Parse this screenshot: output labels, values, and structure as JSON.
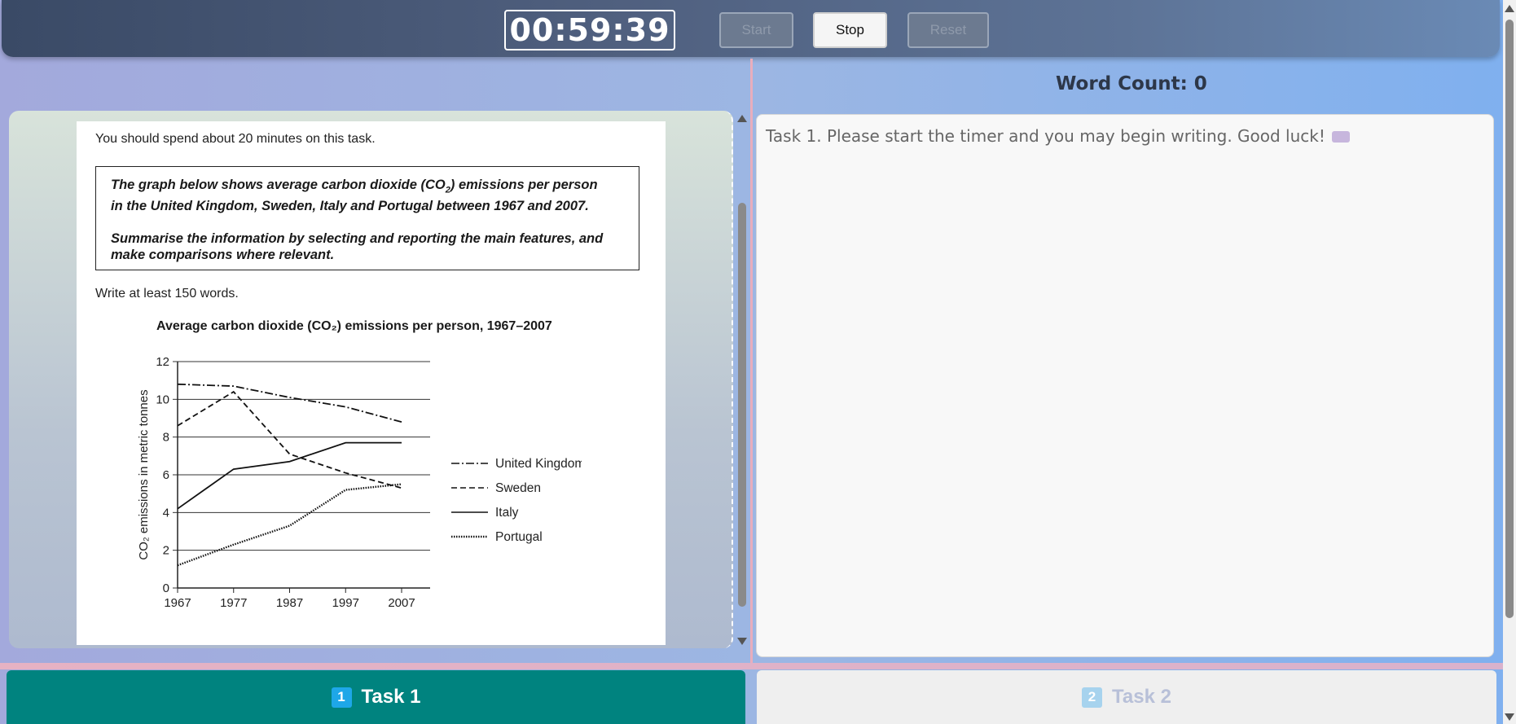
{
  "timer": {
    "value": "00:59:39"
  },
  "controls": {
    "start": "Start",
    "stop": "Stop",
    "reset": "Reset"
  },
  "task_paper": {
    "instruction": "You should spend about 20 minutes on this task.",
    "prompt_line1": "The graph below shows average carbon dioxide (CO",
    "prompt_sub": "2",
    "prompt_line1_end": ") emissions per person",
    "prompt_line2": "in the United Kingdom, Sweden, Italy and Portugal between 1967 and 2007.",
    "prompt_line3": "Summarise the information by selecting and reporting the main features, and",
    "prompt_line4": "make comparisons where relevant.",
    "min_words": "Write at least 150 words."
  },
  "chart_data": {
    "type": "line",
    "title": "Average carbon dioxide (CO₂) emissions per person, 1967–2007",
    "ylabel": "CO₂ emissions in metric tonnes",
    "xlabel": "",
    "x": [
      1967,
      1977,
      1987,
      1997,
      2007
    ],
    "ylim": [
      0,
      12
    ],
    "yticks": [
      0,
      2,
      4,
      6,
      8,
      10,
      12
    ],
    "grid": true,
    "legend_position": "right",
    "series": [
      {
        "name": "United Kingdom",
        "style": "dash-dot",
        "values": [
          10.8,
          10.7,
          10.1,
          9.6,
          8.8
        ]
      },
      {
        "name": "Sweden",
        "style": "dashed",
        "values": [
          8.6,
          10.4,
          7.1,
          6.1,
          5.3
        ]
      },
      {
        "name": "Italy",
        "style": "solid",
        "values": [
          4.2,
          6.3,
          6.7,
          7.7,
          7.7
        ]
      },
      {
        "name": "Portugal",
        "style": "dotted",
        "values": [
          1.2,
          2.3,
          3.3,
          5.2,
          5.5
        ]
      }
    ]
  },
  "word_count": {
    "label": "Word Count: 0"
  },
  "editor": {
    "placeholder": "Task 1. Please start the timer and you may begin writing. Good luck!",
    "icon": "keyboard-icon"
  },
  "tabs": [
    {
      "number": "1",
      "label": "Task 1",
      "active": true
    },
    {
      "number": "2",
      "label": "Task 2",
      "active": false
    }
  ],
  "colors": {
    "tab_active": "#00837f",
    "badge_active": "#1ea7e8",
    "topbar": "#4f5f7e"
  }
}
